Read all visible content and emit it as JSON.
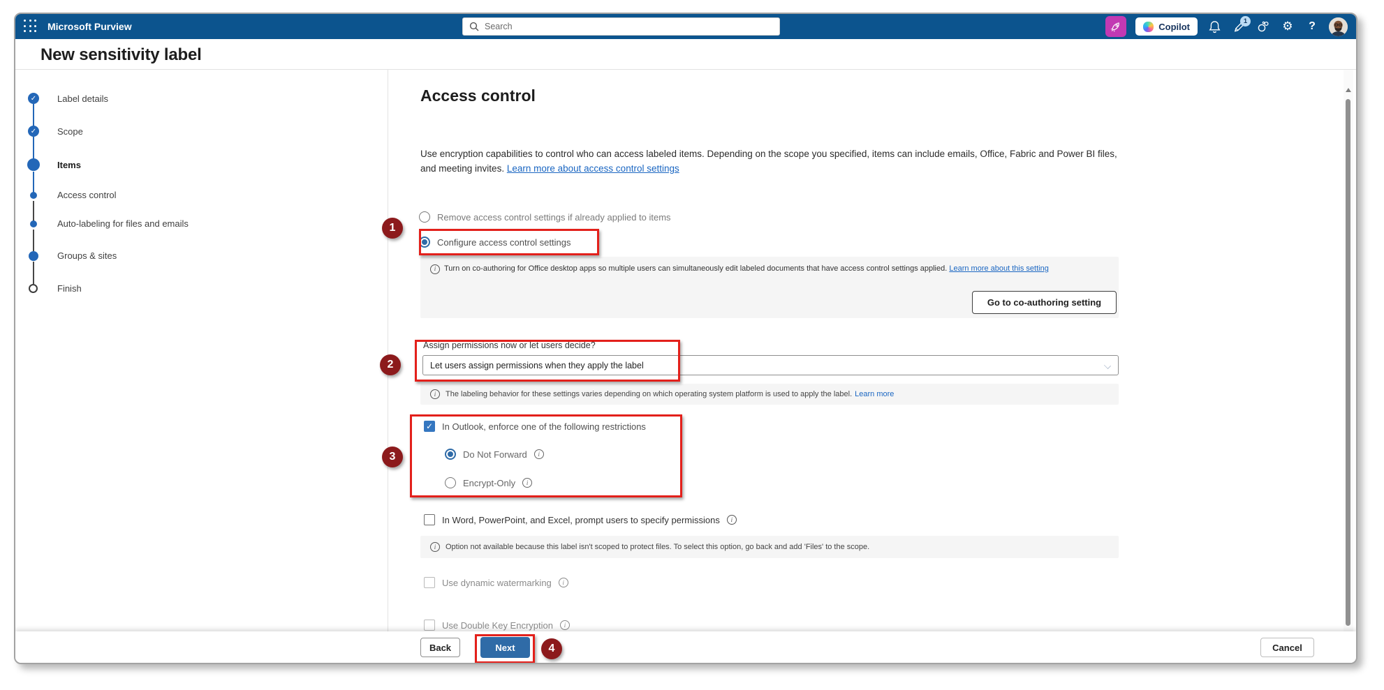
{
  "topbar": {
    "app_name": "Microsoft Purview",
    "search_placeholder": "Search",
    "copilot_label": "Copilot",
    "feedback_badge": "1"
  },
  "page": {
    "title": "New sensitivity label"
  },
  "stepper": {
    "items": [
      {
        "label": "Label details",
        "state": "completed"
      },
      {
        "label": "Scope",
        "state": "completed"
      },
      {
        "label": "Items",
        "state": "current"
      },
      {
        "label": "Access control",
        "state": "upcoming"
      },
      {
        "label": "Auto-labeling for files and emails",
        "state": "upcoming"
      },
      {
        "label": "Groups & sites",
        "state": "upcoming"
      },
      {
        "label": "Finish",
        "state": "upcoming"
      }
    ]
  },
  "main": {
    "heading": "Access control",
    "intro_text": "Use encryption capabilities to control who can access labeled items. Depending on the scope you specified, items can include emails, Office, Fabric and Power BI files, and meeting invites.",
    "intro_link": "Learn more about access control settings",
    "radio_remove_label": "Remove access control settings if already applied to items",
    "radio_configure_label": "Configure access control settings",
    "coauthoring_info": "Turn on co-authoring for Office desktop apps so multiple users can simultaneously edit labeled documents that have access control settings applied.",
    "coauthoring_link": "Learn more about this setting",
    "coauthoring_button": "Go to co-authoring setting",
    "assign_question": "Assign permissions now or let users decide?",
    "assign_selected_value": "Let users assign permissions when they apply the label",
    "labeling_info": "The labeling behavior for these settings varies depending on which operating system platform is used to apply the label.",
    "labeling_link": "Learn more",
    "outlook_checkbox_label": "In Outlook, enforce one of the following restrictions",
    "radio_do_not_forward": "Do Not Forward",
    "radio_encrypt_only": "Encrypt-Only",
    "word_checkbox_label": "In Word, PowerPoint, and Excel, prompt users to specify permissions",
    "scope_info": "Option not available because this label isn't scoped to protect files. To select this option, go back and add 'Files' to the scope.",
    "watermark_checkbox_label": "Use dynamic watermarking",
    "dke_checkbox_label": "Use Double Key Encryption"
  },
  "footer": {
    "back": "Back",
    "next": "Next",
    "cancel": "Cancel"
  },
  "annotations": {
    "n1": "1",
    "n2": "2",
    "n3": "3",
    "n4": "4"
  },
  "colors": {
    "header_blue": "#0C548E",
    "primary_blue": "#2F6BA7",
    "link_blue": "#1A66C2",
    "stepper_blue": "#2367B8",
    "annotation_box_red": "#E3201B",
    "annotation_badge_red": "#8C1A1C",
    "copilot_magenta": "#C239B3"
  }
}
